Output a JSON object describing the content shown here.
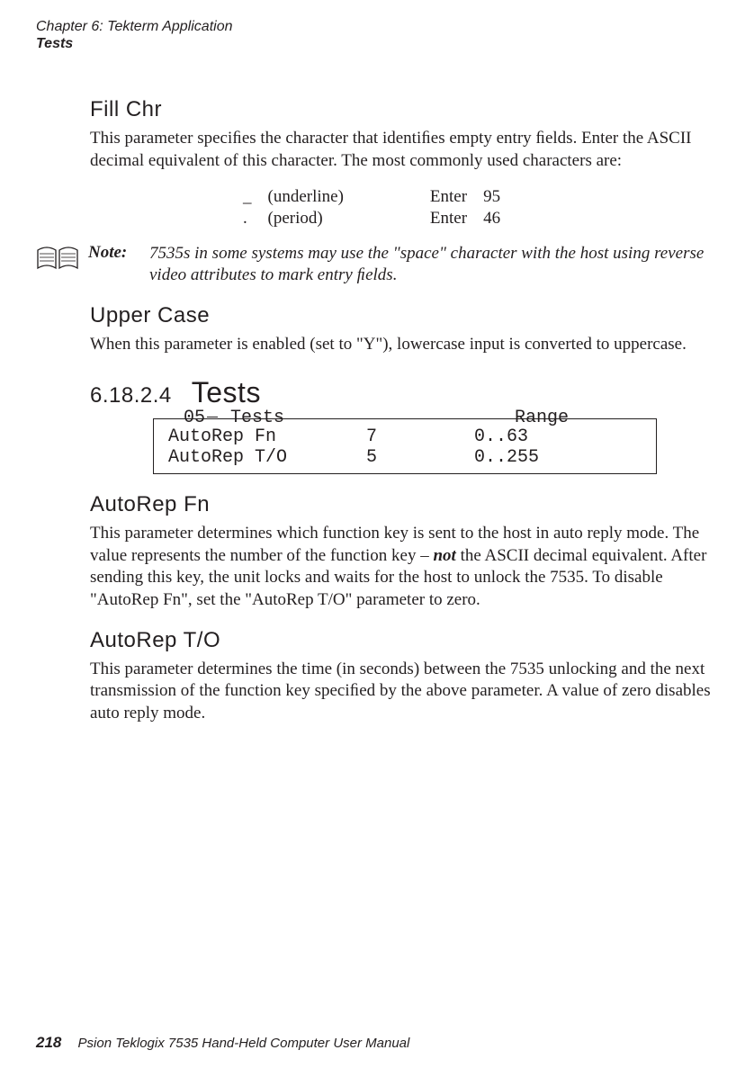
{
  "header": {
    "line1": "Chapter 6: Tekterm Application",
    "line2": "Tests"
  },
  "fillchr": {
    "heading": "Fill Chr",
    "p1": "This parameter speciﬁes the character that identiﬁes empty entry ﬁelds. Enter the ASCII decimal equivalent of this character. The most commonly used characters are:",
    "rows": [
      {
        "sym": "_",
        "name": "(underline)",
        "action": "Enter",
        "code": "95"
      },
      {
        "sym": ".",
        "name": "(period)",
        "action": "Enter",
        "code": "46"
      }
    ]
  },
  "note": {
    "label": "Note:",
    "text": "7535s in some systems may use the \"space\" character with the host using reverse video attributes to mark entry ﬁelds."
  },
  "uppercase": {
    "heading": "Upper Case",
    "p1": "When this parameter is enabled (set to \"Y\"), lowercase input is converted to uppercase."
  },
  "tests_section": {
    "num": "6.18.2.4",
    "title": "Tests",
    "legend_left_prefix": "05",
    "legend_left_label": " Tests",
    "legend_right": "Range",
    "rows": [
      {
        "name": "AutoRep Fn",
        "val": "7",
        "range": "0..63"
      },
      {
        "name": "AutoRep T/O",
        "val": "5",
        "range": "0..255"
      }
    ]
  },
  "autorepfn": {
    "heading": "AutoRep Fn",
    "p_before": "This parameter determines which function key is sent to the host in auto reply mode. The value represents the number of the function key – ",
    "p_bold": "not",
    "p_after": " the ASCII decimal equivalent. After sending this key, the unit locks and waits for the host to unlock the 7535. To disable \"AutoRep Fn\", set the \"AutoRep T/O\" parameter to zero."
  },
  "autorepto": {
    "heading": "AutoRep T/O",
    "p1": "This parameter determines the time (in seconds) between the 7535 unlocking and the next transmission of the function key speciﬁed by the above parameter. A value of zero disables auto reply mode."
  },
  "footer": {
    "page": "218",
    "title": "Psion Teklogix 7535 Hand-Held Computer User Manual"
  }
}
